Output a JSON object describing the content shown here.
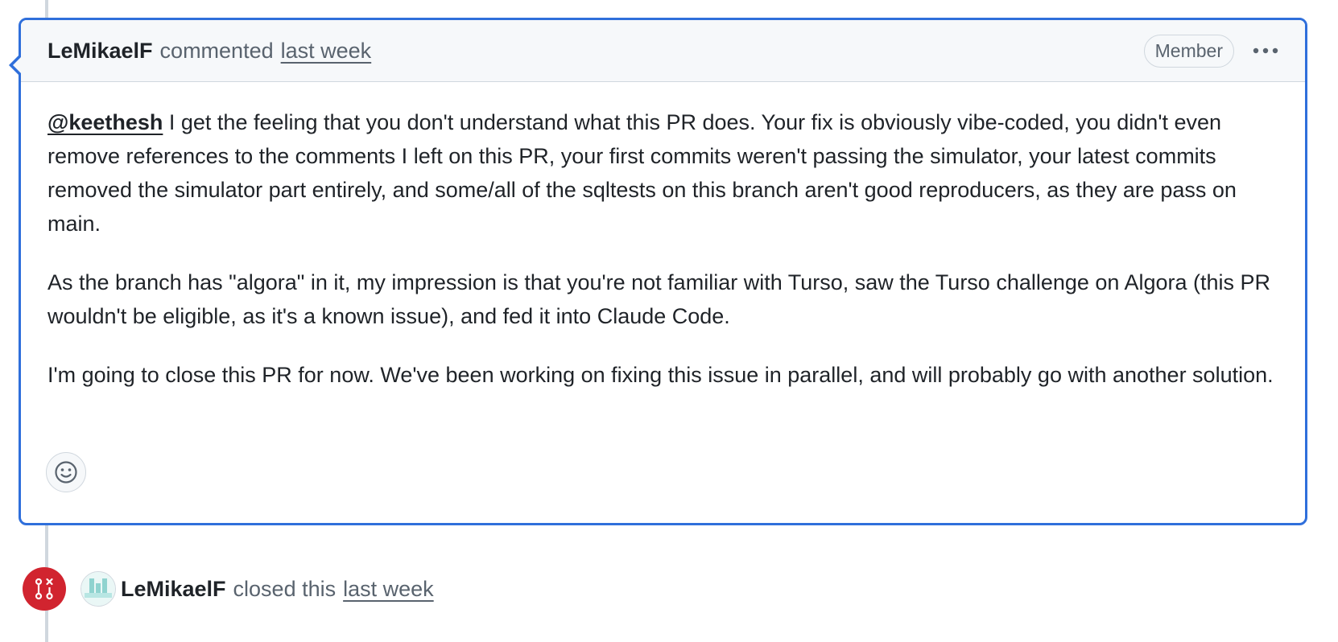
{
  "comment": {
    "author": "LeMikaelF",
    "action": "commented",
    "time": "last week",
    "badge": "Member",
    "menu_icon": "kebab-horizontal-icon",
    "mention": "@keethesh",
    "paragraph1_rest": " I get the feeling that you don't understand what this PR does. Your fix is obviously vibe-coded, you didn't even remove references to the comments I left on this PR, your first commits weren't passing the simulator, your latest commits removed the simulator part entirely, and some/all of the sqltests on this branch aren't good reproducers, as they are pass on main.",
    "paragraph2": "As the branch has \"algora\" in it, my impression is that you're not familiar with Turso, saw the Turso challenge on Algora (this PR wouldn't be eligible, as it's a known issue), and fed it into Claude Code.",
    "paragraph3": "I'm going to close this PR for now. We've been working on fixing this issue in parallel, and will probably go with another solution.",
    "reaction_icon": "smiley-icon"
  },
  "closed_event": {
    "icon": "git-pull-request-closed-icon",
    "author": "LeMikaelF",
    "action": "closed this",
    "time": "last week"
  },
  "colors": {
    "focus_border": "#2f6fdb",
    "closed_red": "#d1242f",
    "muted_text": "#59636e"
  }
}
